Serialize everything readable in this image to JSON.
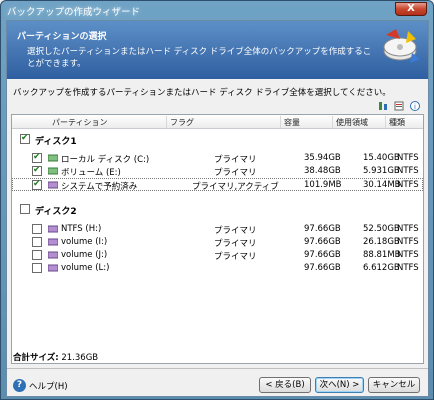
{
  "window": {
    "title": "バックアップの作成ウィザード",
    "close_label": "X"
  },
  "banner": {
    "title": "パーティションの選択",
    "description": "選択したパーティションまたはハード ディスク ドライブ全体のバックアップを作成することができます。"
  },
  "instruction": "バックアップを作成するパーティションまたはハード ディスク ドライブ全体を選択してください。",
  "toolbar": {
    "icons": [
      "sort-icon",
      "properties-icon",
      "info-icon"
    ],
    "info_glyph": "i"
  },
  "columns": {
    "partition": "パーティション",
    "flags": "フラグ",
    "capacity": "容量",
    "used": "使用領域",
    "type": "種類"
  },
  "disks": [
    {
      "label": "ディスク1",
      "checked": true,
      "partitions": [
        {
          "name": "ローカル ディスク (C:)",
          "flags": "プライマリ",
          "capacity": "35.94GB",
          "used": "15.40GB",
          "type": "NTFS",
          "checked": true
        },
        {
          "name": "ボリューム (E:)",
          "flags": "プライマリ",
          "capacity": "38.48GB",
          "used": "5.931GB",
          "type": "NTFS",
          "checked": true
        },
        {
          "name": "システムで予約済み",
          "flags": "プライマリ,アクティブ",
          "capacity": "101.9MB",
          "used": "30.14MB",
          "type": "NTFS",
          "checked": true
        }
      ]
    },
    {
      "label": "ディスク2",
      "checked": false,
      "partitions": [
        {
          "name": "NTFS (H:)",
          "flags": "プライマリ",
          "capacity": "97.66GB",
          "used": "52.50GB",
          "type": "NTFS",
          "checked": false
        },
        {
          "name": "volume (I:)",
          "flags": "プライマリ",
          "capacity": "97.66GB",
          "used": "26.18GB",
          "type": "NTFS",
          "checked": false
        },
        {
          "name": "volume (J:)",
          "flags": "プライマリ",
          "capacity": "97.66GB",
          "used": "88.81MB",
          "type": "NTFS",
          "checked": false
        },
        {
          "name": "volume (L:)",
          "flags": "",
          "capacity": "97.66GB",
          "used": "6.612GB",
          "type": "NTFS",
          "checked": false
        }
      ]
    }
  ],
  "total": {
    "label": "合計サイズ:",
    "value": "21.36GB"
  },
  "footer": {
    "help_glyph": "?",
    "help": "ヘルプ(H)",
    "back": "< 戻る(B)",
    "next": "次へ(N) >",
    "cancel": "キャンセル"
  },
  "colors": {
    "banner": "#2f5fa0",
    "accent": "#1c7b1c",
    "close": "#c9472e"
  }
}
